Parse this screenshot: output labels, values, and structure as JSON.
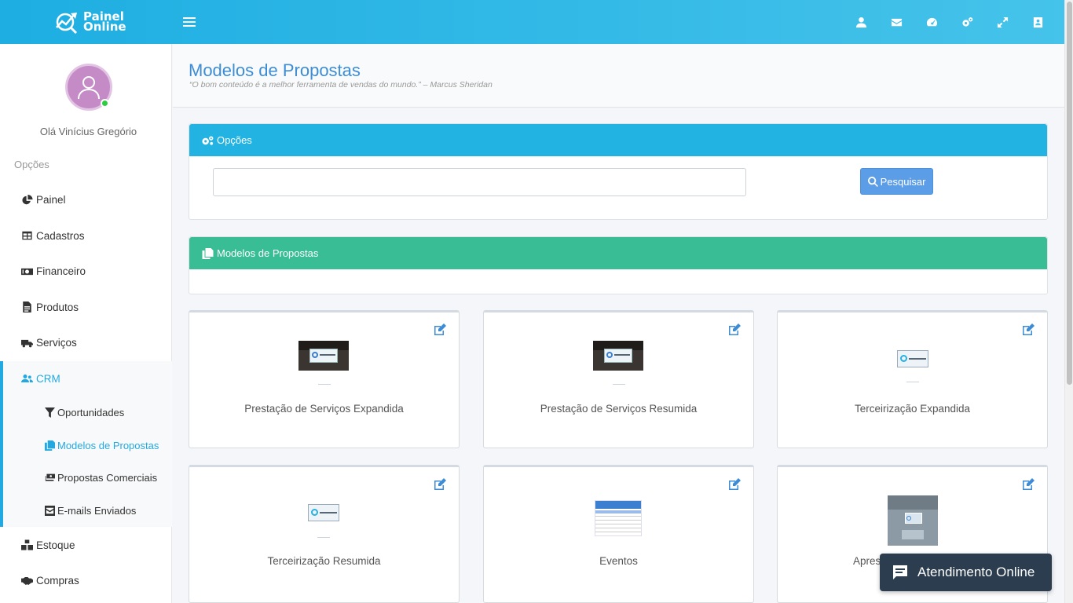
{
  "brand": {
    "line1": "Painel",
    "line2": "Online"
  },
  "header": {
    "icons": [
      "user-icon",
      "envelope-icon",
      "dashboard-icon",
      "cogs-icon",
      "expand-icon",
      "address-book-icon"
    ]
  },
  "sidebar": {
    "greeting": "Olá Vinícius Gregório",
    "section_label": "Opções",
    "items": [
      {
        "label": "Painel",
        "icon": "pie-chart-icon"
      },
      {
        "label": "Cadastros",
        "icon": "table-icon"
      },
      {
        "label": "Financeiro",
        "icon": "money-icon"
      },
      {
        "label": "Produtos",
        "icon": "file-icon"
      },
      {
        "label": "Serviços",
        "icon": "truck-icon"
      },
      {
        "label": "CRM",
        "icon": "users-icon"
      },
      {
        "label": "Estoque",
        "icon": "cubes-icon"
      },
      {
        "label": "Compras",
        "icon": "handshake-icon"
      }
    ],
    "crm_subitems": [
      {
        "label": "Oportunidades",
        "icon": "filter-icon"
      },
      {
        "label": "Modelos de Propostas",
        "icon": "copy-icon"
      },
      {
        "label": "Propostas Comerciais",
        "icon": "money-stack-icon"
      },
      {
        "label": "E-mails Enviados",
        "icon": "envelope-square-icon"
      }
    ]
  },
  "page": {
    "title": "Modelos de Propostas",
    "quote": "“O bom conteúdo é a melhor ferramenta de vendas do mundo.” – Marcus Sheridan"
  },
  "options_panel": {
    "title": "Opções",
    "search_value": "",
    "search_button": "Pesquisar"
  },
  "models_panel": {
    "title": "Modelos de Propostas"
  },
  "cards": [
    {
      "title": "Prestação de Serviços Expandida"
    },
    {
      "title": "Prestação de Serviços Resumida"
    },
    {
      "title": "Terceirização Expandida"
    },
    {
      "title": "Terceirização Resumida"
    },
    {
      "title": "Eventos"
    },
    {
      "title": "Apres"
    }
  ],
  "chat": {
    "label": "Atendimento Online"
  },
  "colors": {
    "topbar": "#1eaee2",
    "accent": "#23a9e1",
    "green": "#38bd95",
    "title": "#3c8dd6"
  }
}
